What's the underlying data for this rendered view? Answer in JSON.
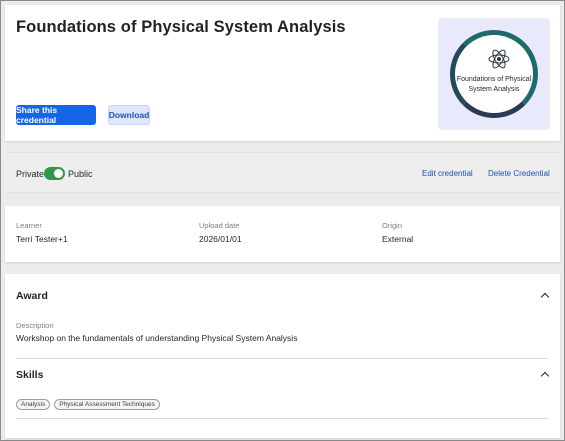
{
  "credential": {
    "title": "Foundations of Physical System Analysis",
    "share_label": "Share this credential",
    "download_label": "Download",
    "badge_text": "Foundations of Physical System Analysis"
  },
  "visibility": {
    "private_label": "Private",
    "public_label": "Public",
    "is_public": true,
    "edit_label": "Edit credential",
    "delete_label": "Delete Credential"
  },
  "info": {
    "learner_label": "Learner",
    "learner_value": "Terri Tester+1",
    "upload_label": "Upload date",
    "upload_value": "2026/01/01",
    "origin_label": "Origin",
    "origin_value": "External"
  },
  "award": {
    "heading": "Award",
    "description_label": "Description",
    "description_value": "Workshop on the fundamentals of understanding Physical System Analysis"
  },
  "skills": {
    "heading": "Skills",
    "items": [
      "Analysis",
      "Physical Assessment Techniques"
    ]
  },
  "colors": {
    "primary": "#1565e6",
    "toggle_on": "#2e9a4a",
    "link": "#1f4fb8"
  },
  "icons": {
    "badge_icon": "atom-icon",
    "collapse_icon": "chevron-up-icon"
  }
}
